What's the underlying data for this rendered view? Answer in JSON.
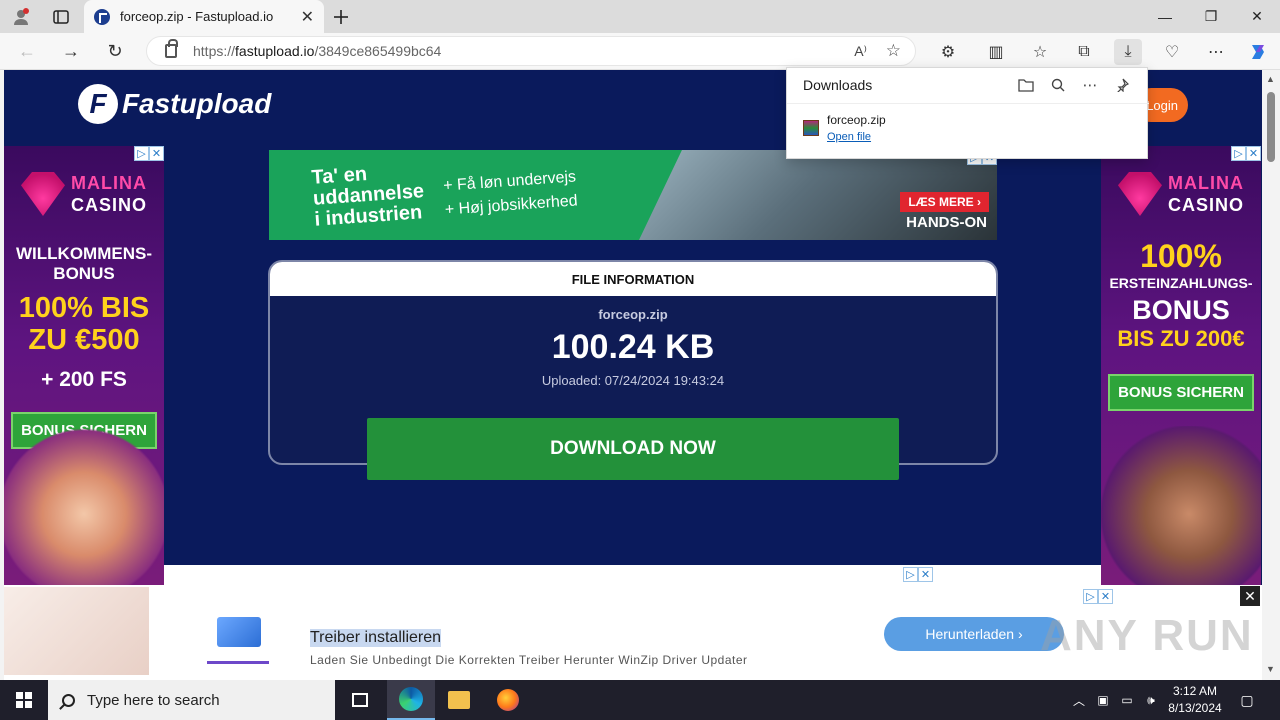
{
  "browser": {
    "tab_title": "forceop.zip - Fastupload.io",
    "new_tab_icon": "plus-icon",
    "url_prefix": "https://",
    "url_host": "fastupload.io",
    "url_path": "/3849ce865499bc64"
  },
  "downloads_panel": {
    "title": "Downloads",
    "file_name": "forceop.zip",
    "open_label": "Open file"
  },
  "site": {
    "logo_text": "Fastupload",
    "logo_mark": "F",
    "login_label": "Login"
  },
  "left_ad": {
    "brand_top": "MALINA",
    "brand_bottom": "CASINO",
    "line1": "WILLKOMMENS-",
    "line2": "BONUS",
    "line3": "100% BIS",
    "line4": "ZU €500",
    "line5": "+ 200 FS",
    "button": "BONUS SICHERN"
  },
  "right_ad": {
    "brand_top": "MALINA",
    "brand_bottom": "CASINO",
    "line1": "100%",
    "line2": "ERSTEINZAHLUNGS-",
    "line3": "BONUS",
    "line4": "BIS ZU 200€",
    "button": "BONUS SICHERN"
  },
  "top_banner": {
    "title_1": "Ta' en",
    "title_2": "uddannelse",
    "title_3": "i industrien",
    "bullet_1": "+ Få løn undervejs",
    "bullet_2": "+ Høj jobsikkerhed",
    "cta": "LÆS MERE ›",
    "tag": "HANDS-ON"
  },
  "file_info": {
    "header": "FILE INFORMATION",
    "name": "forceop.zip",
    "size": "100.24 KB",
    "uploaded": "Uploaded: 07/24/2024 19:43:24",
    "download_label": "DOWNLOAD NOW"
  },
  "bottom_ad": {
    "title": "Treiber installieren",
    "subtitle": "Laden Sie Unbedingt Die Korrekten Treiber Herunter WinZip Driver Updater",
    "button": "Herunterladen  ›",
    "watermark": "ANY RUN"
  },
  "taskbar": {
    "search_placeholder": "Type here to search",
    "time": "3:12 AM",
    "date": "8/13/2024"
  }
}
